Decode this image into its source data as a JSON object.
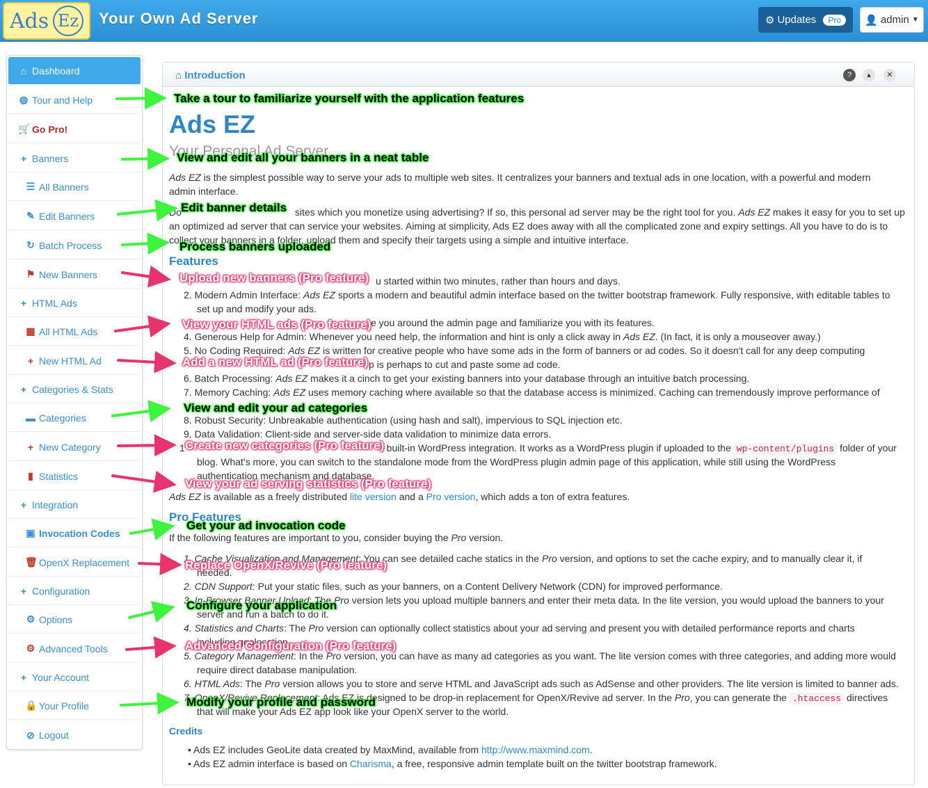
{
  "navbar": {
    "logo_left": "Ads",
    "logo_right": "Ez",
    "title": "Your Own Ad Server",
    "updates_label": "Updates",
    "updates_badge": "Pro",
    "user_label": "admin"
  },
  "sidebar": {
    "items": [
      {
        "label": "Dashboard",
        "icon": "home-icon"
      },
      {
        "label": "Tour and Help",
        "icon": "globe-icon"
      },
      {
        "label": "Go Pro!",
        "icon": "cart-icon"
      },
      {
        "label": "Banners",
        "icon": "plus-icon"
      },
      {
        "label": "All Banners",
        "icon": "list-icon"
      },
      {
        "label": "Edit Banners",
        "icon": "pencil-icon"
      },
      {
        "label": "Batch Process",
        "icon": "refresh-icon"
      },
      {
        "label": "New Banners",
        "icon": "flag-icon"
      },
      {
        "label": "HTML Ads",
        "icon": "plus-icon"
      },
      {
        "label": "All HTML Ads",
        "icon": "grid-icon"
      },
      {
        "label": "New HTML Ad",
        "icon": "plus-icon"
      },
      {
        "label": "Categories & Stats",
        "icon": "plus-icon"
      },
      {
        "label": "Categories",
        "icon": "folder-icon"
      },
      {
        "label": "New Category",
        "icon": "plus-icon"
      },
      {
        "label": "Statistics",
        "icon": "bar-chart-icon"
      },
      {
        "label": "Integration",
        "icon": "plus-icon"
      },
      {
        "label": "Invocation Codes",
        "icon": "picture-icon"
      },
      {
        "label": "OpenX Replacement",
        "icon": "trash-icon"
      },
      {
        "label": "Configuration",
        "icon": "plus-icon"
      },
      {
        "label": "Options",
        "icon": "gear-icon"
      },
      {
        "label": "Advanced Tools",
        "icon": "cog-icon"
      },
      {
        "label": "Your Account",
        "icon": "plus-icon"
      },
      {
        "label": "Your Profile",
        "icon": "lock-icon"
      },
      {
        "label": "Logout",
        "icon": "ban-icon"
      }
    ]
  },
  "box": {
    "title": "Introduction"
  },
  "content": {
    "h1": "Ads EZ",
    "subtitle": "Your Personal Ad Server",
    "intro1a": "Ads EZ",
    "intro1b": " is the simplest possible way to serve your ads to multiple web sites. It centralizes your banners and textual ads in one location, with a powerful and modern",
    "intro1c": "admin interface.",
    "intro2a": "Do",
    "intro2b": "sites which you monetize using advertising? If so, this personal ad server may be the right tool for you. ",
    "intro2c": "Ads EZ",
    "intro2d": " makes it easy for you to set up",
    "intro2e": "an optimized ad server that can service your websites. Aiming at simplicity, Ads EZ does away with all the complicated zone and expiry settings. All you have to do is to",
    "intro2f": "collect your banners in a folder, upload them and specify their targets using a simple and intuitive interface.",
    "features_heading": "Features",
    "f1": "u started within two minutes, rather than hours and days.",
    "f2a": "2.  Modern Admin Interface: ",
    "f2b": "Ads EZ",
    "f2c": " sports a modern and beautiful admin interface based on the twitter bootstrap framework. Fully responsive, with editable tables to",
    "f2d": "set up and modify your ads.",
    "f3": "e you around the admin page and familiarize you with its features.",
    "f4a": "4.  Generous Help for Admin: Whenever you need help, the information and hint is only a click away in ",
    "f4b": "Ads EZ",
    "f4c": ". (In fact, it is only a mouseover away.)",
    "f5a": "5.  No Coding Required: ",
    "f5b": "Ads EZ",
    "f5c": " is written for creative people who have some ads in the form of banners or ad codes. So it doesn't call for any deep computing",
    "f5d": "p is perhaps to cut and paste some ad code.",
    "f6a": "6.  Batch Processing: ",
    "f6b": "Ads EZ",
    "f6c": " makes it a cinch to get your existing banners into your database through an intuitive batch processing.",
    "f7a": "7.  Memory Caching: ",
    "f7b": "Ads EZ",
    "f7c": " uses memory caching where available so that the database access is minimized. Caching can tremendously improve performance of",
    "f8": "8.  Robust Security: Unbreakable authentication (using hash and salt), impervious to SQL injection etc.",
    "f9": "9.  Data Validation: Client-side and server-side data validation to minimize data errors.",
    "f10a": "1",
    "f10b": " built-in WordPress integration. It works as a WordPress plugin if uploaded to the ",
    "f10code": "wp-content/plugins",
    "f10c": " folder of your",
    "f10d": "blog. What's more, you can switch to the standalone mode from the WordPress plugin admin page of this application, while still using the WordPress",
    "f10e": "authentication mechanism and database.",
    "avail_a": "Ads EZ",
    "avail_b": " is available as a freely distributed ",
    "avail_lite": "lite version",
    "avail_c": " and a ",
    "avail_pro": "Pro version",
    "avail_d": ", which adds a ton of extra features.",
    "pro_heading": "Pro Features",
    "pro_intro_a": "If the following features are important to you, consider buying the ",
    "pro_intro_b": "Pro",
    "pro_intro_c": " version.",
    "p1a": "1.  Cache Visualization and Management",
    "p1b": ": You can see detailed cache statics in the ",
    "p1c": "Pro",
    "p1d": " version, and options to set the cache expiry, and to manually clear it, if",
    "p1e": "needed.",
    "p2a": "2.  CDN Support",
    "p2b": ": Put your static files, such as your banners, on a Content Delivery Network (CDN) for improved performance.",
    "p3a": "3.  In-Browser Banner Upload",
    "p3b": ": The ",
    "p3c": "Pro",
    "p3d": " version lets you upload multiple banners and enter their meta data. In the lite version, you would upload the banners to your",
    "p3e": "server and run a batch to do it.",
    "p4a": "4.  Statistics and Charts",
    "p4b": ": The ",
    "p4c": "Pro",
    "p4d": " version can optionally collect statistics about your ad serving and present you with detailed performance reports and charts",
    "p4e": "including geolocation.",
    "p5a": "5.  Category Management",
    "p5b": ": In the ",
    "p5c": "Pro",
    "p5d": " version, you can have as many ad categories as you want. The lite version comes with three categories, and adding more would",
    "p5e": "require direct database manipulation.",
    "p6a": "6.  HTML Ads",
    "p6b": ": The ",
    "p6c": "Pro",
    "p6d": " version allows you to store and serve HTML and JavaScript ads such as AdSense and other providers. The lite version is limited to banner ads.",
    "p7a": "7.  OpenX/Revive Replacement",
    "p7b": ": Ads EZ is designed to be drop-in replacement for OpenX/Revive ad server. In the ",
    "p7c": "Pro",
    "p7d": ", you can generate the ",
    "p7code": ".htaccess",
    "p7e": " directives",
    "p7f": "that will make your Ads EZ app look like your OpenX server to the world.",
    "credits_heading": "Credits",
    "c1a": "•  Ads EZ includes GeoLite data created by MaxMind, available from ",
    "c1link": "http://www.maxmind.com",
    "c1b": ".",
    "c2a": "•  Ads EZ admin interface is based on ",
    "c2link": "Charisma",
    "c2b": ", a free, responsive admin template built on the twitter bootstrap framework."
  },
  "annotations": [
    {
      "text": "Take a tour to familiarize yourself with the application features",
      "color": "green"
    },
    {
      "text": "View and edit all your banners in a neat table",
      "color": "green"
    },
    {
      "text": "Edit banner details",
      "color": "green"
    },
    {
      "text": "Process banners uploaded",
      "color": "green"
    },
    {
      "text": "Upload new banners (Pro feature)",
      "color": "red"
    },
    {
      "text": "View your HTML ads (Pro feature)",
      "color": "red"
    },
    {
      "text": "Add a new HTML ad (Pro feature)",
      "color": "red"
    },
    {
      "text": "View and edit your  ad categories",
      "color": "green"
    },
    {
      "text": "Create new categories (Pro feature)",
      "color": "red"
    },
    {
      "text": "View your ad serving statistics (Pro feature)",
      "color": "red"
    },
    {
      "text": "Get your ad invocation code",
      "color": "green"
    },
    {
      "text": "Replace OpenX/Revive (Pro feature)",
      "color": "red"
    },
    {
      "text": "Configure your application",
      "color": "green"
    },
    {
      "text": "Advanced Configuration (Pro feature)",
      "color": "red"
    },
    {
      "text": "Modify your profile and password",
      "color": "green"
    }
  ],
  "colors": {
    "navbar": "#2b8fd6",
    "link": "#2a8ad8",
    "annotation_green": "#3df53d",
    "annotation_red": "#e8336b"
  }
}
